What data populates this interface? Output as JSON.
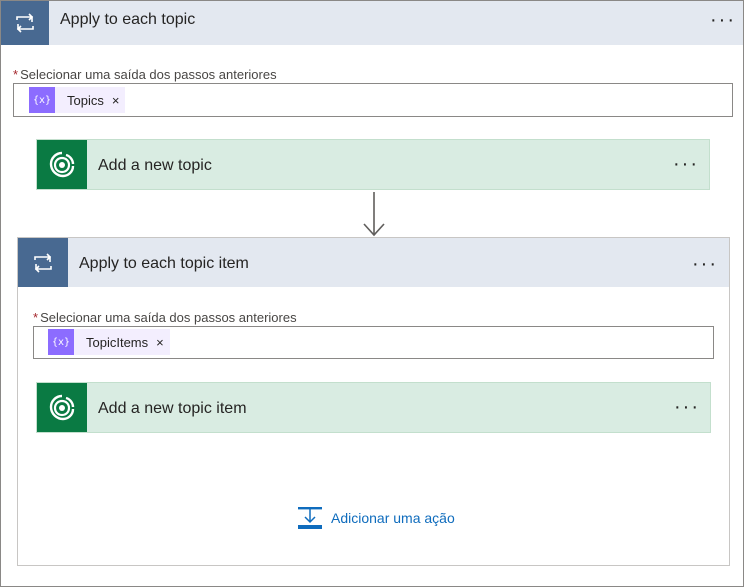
{
  "outer_loop": {
    "title": "Apply to each topic",
    "more_label": "···",
    "field": {
      "required_mark": "*",
      "label": "Selecionar uma saída dos passos anteriores",
      "token": {
        "icon_text": "{x}",
        "label": "Topics",
        "remove": "×"
      }
    }
  },
  "action_add_topic": {
    "title": "Add a new topic",
    "more_label": "···"
  },
  "inner_loop": {
    "title": "Apply to each topic item",
    "more_label": "···",
    "field": {
      "required_mark": "*",
      "label": "Selecionar uma saída dos passos anteriores",
      "token": {
        "icon_text": "{x}",
        "label": "TopicItems",
        "remove": "×"
      }
    }
  },
  "action_add_topic_item": {
    "title": "Add a new topic item",
    "more_label": "···"
  },
  "add_action": {
    "label": "Adicionar uma ação"
  },
  "colors": {
    "loop_header": "#e3e8f0",
    "loop_icon": "#486991",
    "action_card": "#d9ece2",
    "action_icon": "#0a7a43",
    "token_icon": "#8c6cff",
    "link": "#0f6cbd"
  },
  "icons": {
    "loop": "loop-icon",
    "dataverse": "dataverse-icon",
    "token": "expression-icon",
    "arrow": "arrow-down-icon",
    "add_action": "insert-action-icon"
  }
}
